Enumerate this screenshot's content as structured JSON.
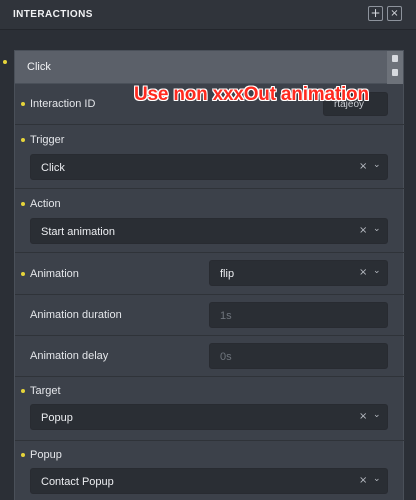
{
  "header": {
    "title": "INTERACTIONS",
    "add_icon": "+",
    "close_icon": "×"
  },
  "interaction": {
    "title": "Click",
    "id_label": "Interaction ID",
    "id_value": "rtajeoy",
    "trigger_label": "Trigger",
    "trigger_value": "Click",
    "action_label": "Action",
    "action_value": "Start animation",
    "animation_label": "Animation",
    "animation_value": "flip",
    "duration_label": "Animation duration",
    "duration_placeholder": "1s",
    "delay_label": "Animation delay",
    "delay_placeholder": "0s",
    "target_label": "Target",
    "target_value": "Popup",
    "popup_label": "Popup",
    "popup_value": "Contact Popup"
  },
  "annotation": "Use non xxxOut animation",
  "icons": {
    "clear": "×",
    "dropdown": "⌄",
    "copy": "copy-icon",
    "delete": "trash-icon"
  },
  "colors": {
    "accent_dot": "#e6d43a",
    "annotation": "#ff2a1f"
  }
}
